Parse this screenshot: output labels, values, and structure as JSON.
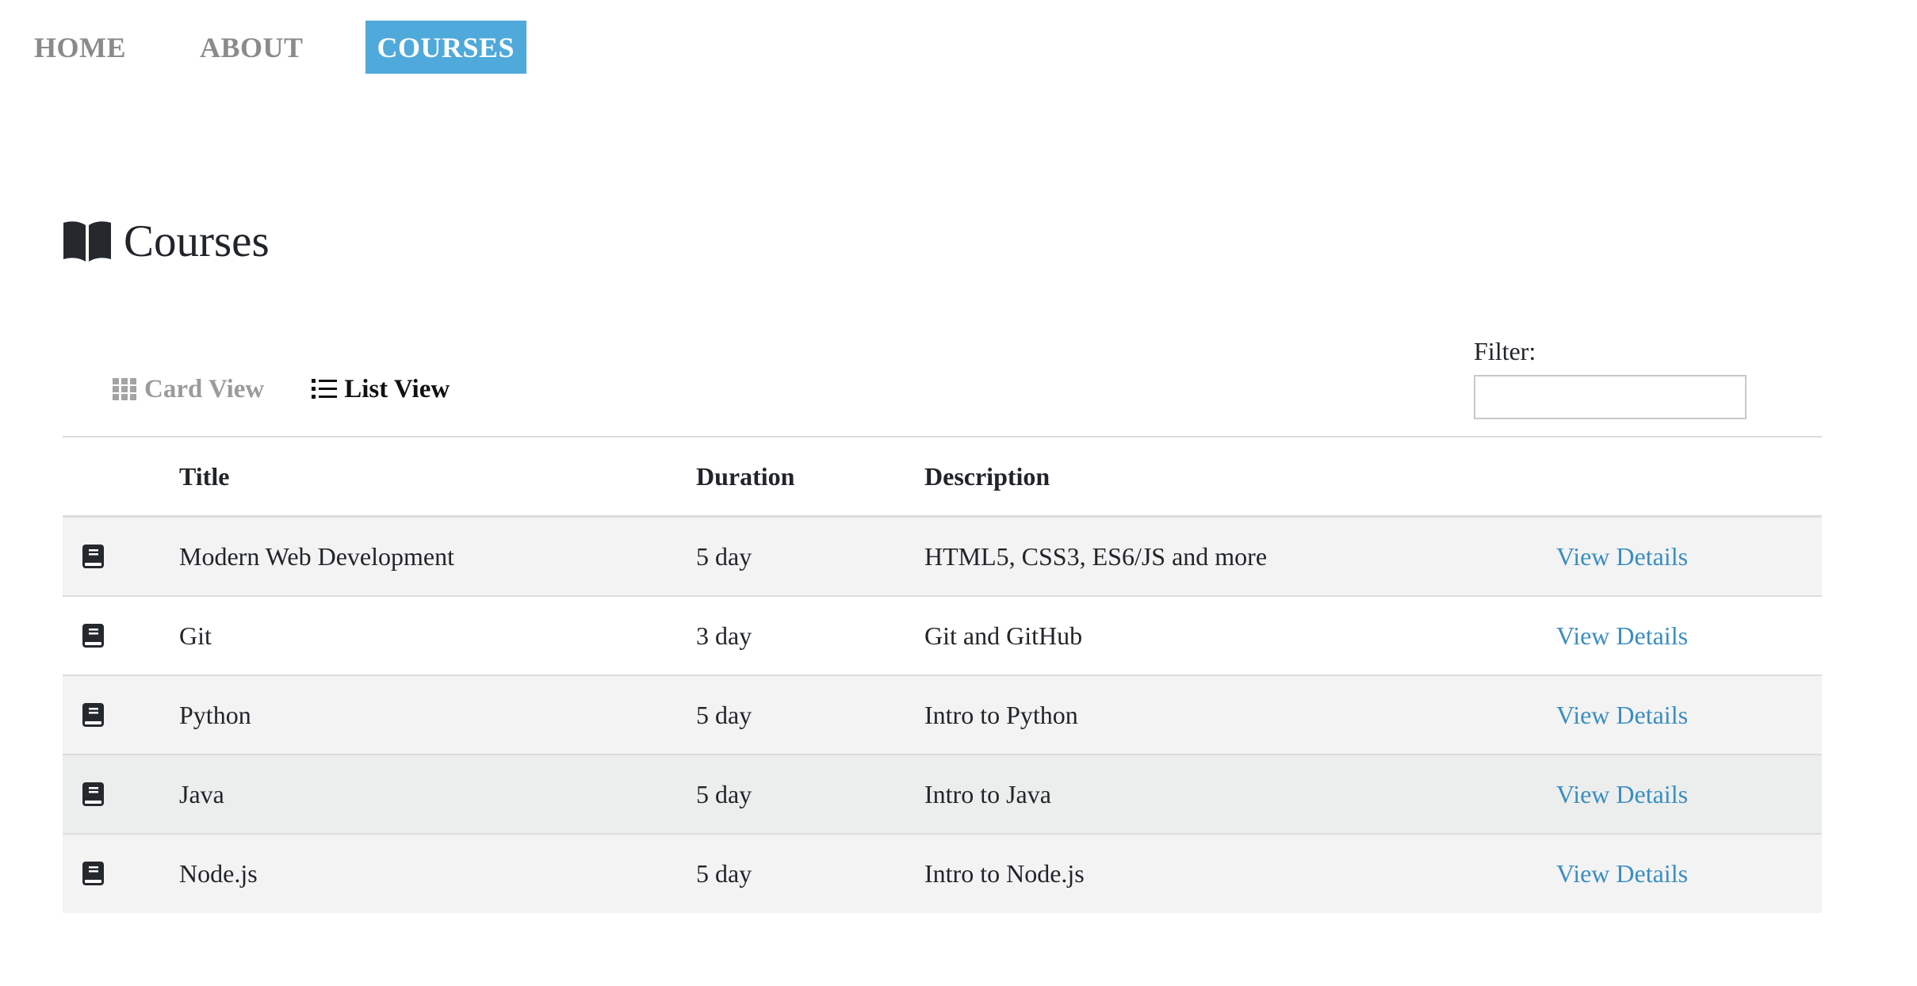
{
  "nav": {
    "items": [
      {
        "label": "HOME",
        "active": false
      },
      {
        "label": "ABOUT",
        "active": false
      },
      {
        "label": "COURSES",
        "active": true
      }
    ]
  },
  "page": {
    "title": "Courses",
    "title_icon": "open-book-icon"
  },
  "views": {
    "card_label": "Card View",
    "card_icon": "grid-icon",
    "list_label": "List View",
    "list_icon": "list-icon",
    "active": "list"
  },
  "filter": {
    "label": "Filter:",
    "value": "",
    "placeholder": ""
  },
  "table": {
    "columns": [
      "",
      "Title",
      "Duration",
      "Description",
      ""
    ],
    "rows": [
      {
        "icon": "book-icon",
        "title": "Modern Web Development",
        "duration": "5 day",
        "description": "HTML5, CSS3, ES6/JS and more",
        "action": "View Details"
      },
      {
        "icon": "book-icon",
        "title": "Git",
        "duration": "3 day",
        "description": "Git and GitHub",
        "action": "View Details"
      },
      {
        "icon": "book-icon",
        "title": "Python",
        "duration": "5 day",
        "description": "Intro to Python",
        "action": "View Details"
      },
      {
        "icon": "book-icon",
        "title": "Java",
        "duration": "5 day",
        "description": "Intro to Java",
        "action": "View Details"
      },
      {
        "icon": "book-icon",
        "title": "Node.js",
        "duration": "5 day",
        "description": "Intro to Node.js",
        "action": "View Details"
      }
    ]
  },
  "colors": {
    "nav_active_bg": "#4fa9da",
    "link": "#3a8ec0",
    "row_stripe": "#f3f3f3"
  }
}
